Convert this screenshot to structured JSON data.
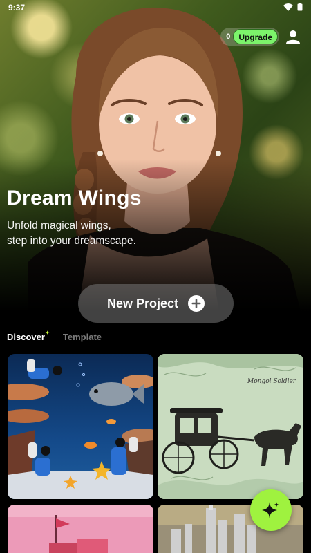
{
  "status_bar": {
    "time": "9:37",
    "icons": [
      "wifi-icon",
      "battery-icon"
    ]
  },
  "header": {
    "credits": "0",
    "upgrade_label": "Upgrade",
    "profile_icon": "person-icon"
  },
  "hero": {
    "title": "Dream Wings",
    "subtitle": "Unfold magical wings,\nstep into your dreamscape."
  },
  "new_project": {
    "label": "New Project",
    "icon": "plus-circle-icon"
  },
  "tabs": [
    {
      "label": "Discover",
      "active": true
    },
    {
      "label": "Template",
      "active": false
    }
  ],
  "grid": {
    "items": [
      {
        "image": "underwater-divers-scene"
      },
      {
        "image": "vintage-horse-carriage-illustration"
      },
      {
        "image": "pink-sailboat-scene"
      },
      {
        "image": "miniature-city-skyline"
      }
    ],
    "text_in_image": "Mongol Soldier"
  },
  "fab": {
    "icon": "sparkle-icon"
  },
  "colors": {
    "accent": "#9ff23f",
    "upgrade": "#7cf36b",
    "background": "#000000"
  }
}
